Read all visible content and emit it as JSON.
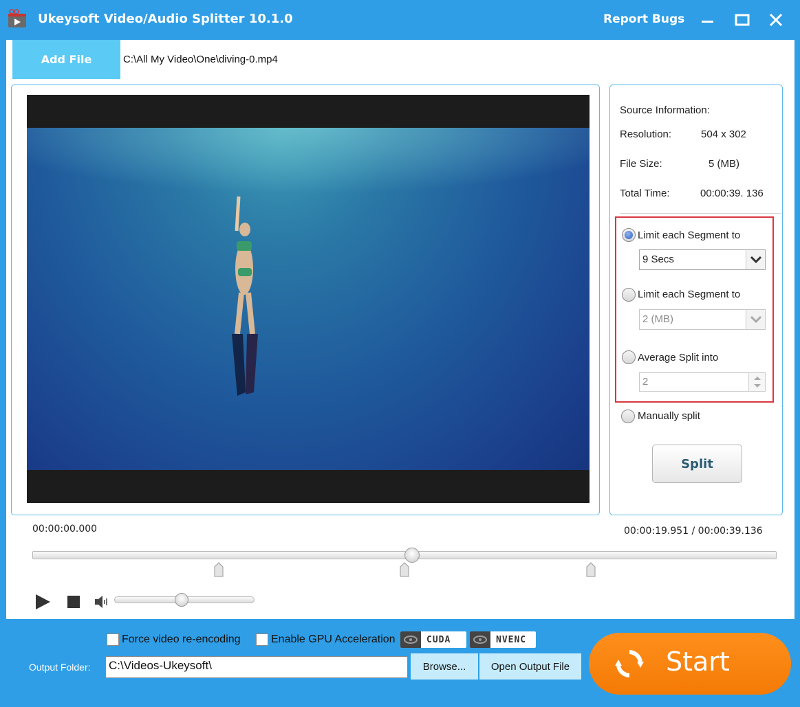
{
  "window": {
    "title": "Ukeysoft Video/Audio Splitter 10.1.0",
    "report_bugs": "Report Bugs"
  },
  "toolbar": {
    "add_file_label": "Add File",
    "file_path": "C:\\All My Video\\One\\diving-0.mp4"
  },
  "source_info": {
    "heading": "Source Information:",
    "resolution_label": "Resolution:",
    "resolution_value": "504 x 302",
    "file_size_label": "File Size:",
    "file_size_value": "5 (MB)",
    "total_time_label": "Total Time:",
    "total_time_value": "00:00:39. 136"
  },
  "split_options": {
    "by_time_label": "Limit each Segment to",
    "by_time_value": "9 Secs",
    "by_size_label": "Limit each Segment to",
    "by_size_value": "2 (MB)",
    "average_label": "Average Split into",
    "average_value": "2",
    "manual_label": "Manually split",
    "selected": "by_time",
    "split_button": "Split"
  },
  "playback": {
    "current_start": "00:00:00.000",
    "position_readout": "00:00:19.951 / 00:00:39.136",
    "position_fraction": 0.51,
    "volume_fraction": 0.48,
    "split_markers_fraction": [
      0.25,
      0.5,
      0.75
    ]
  },
  "output": {
    "force_reencode_label": "Force video re-encoding",
    "gpu_label": "Enable GPU Acceleration",
    "cuda_label": "CUDA",
    "nvenc_label": "NVENC",
    "folder_label": "Output Folder:",
    "folder_value": "C:\\Videos-Ukeysoft\\",
    "browse_label": "Browse...",
    "open_output_label": "Open Output File",
    "start_label": "Start"
  },
  "colors": {
    "title_bar": "#2f9ee6",
    "accent_light": "#5bcaf5",
    "highlight_box": "#d9363e",
    "start_button": "#f47a05"
  }
}
